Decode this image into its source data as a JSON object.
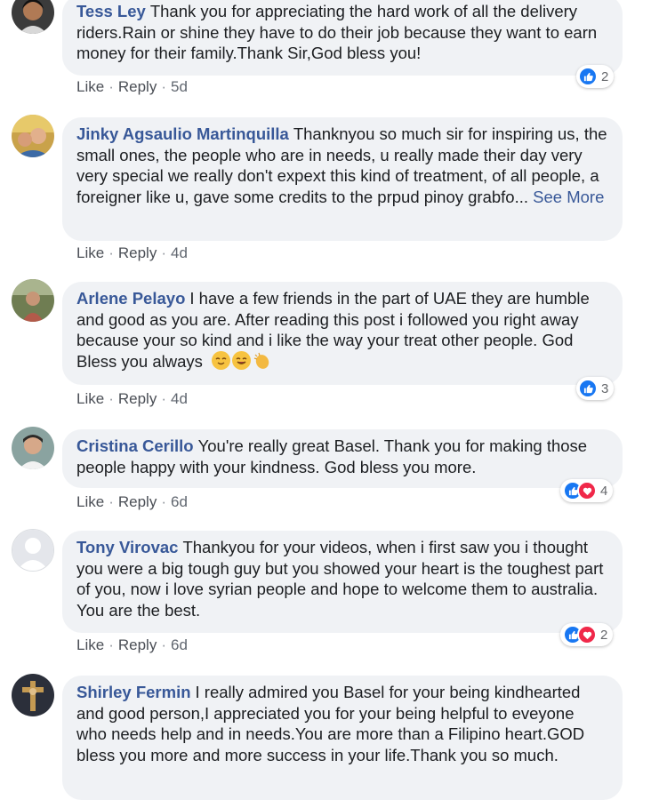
{
  "comments": [
    {
      "author": "Tess Ley",
      "text": "Thank you for appreciating the hard work of all the delivery riders.Rain or shine they have to do their job because they want to earn money for their family.Thank Sir,God bless you!",
      "actions": {
        "like": "Like",
        "reply": "Reply",
        "time": "5d"
      },
      "reactions": {
        "count": "2",
        "types": [
          "like"
        ]
      }
    },
    {
      "author": "Jinky Agsaulio Martinquilla",
      "text": "Thanknyou so much sir for inspiring us, the small ones, the people who are in needs, u really made their day very very special we really don't expext this kind of treatment, of all people, a foreigner like u, gave some credits to the prpud pinoy grabfo...",
      "see_more": "See More",
      "actions": {
        "like": "Like",
        "reply": "Reply",
        "time": "4d"
      }
    },
    {
      "author": "Arlene Pelayo",
      "text": "I have a few friends in the part of UAE they are humble and good as you are. After reading this post i followed you right away because your so kind and i like the way your treat other people. God Bless you always",
      "emojis": [
        "relieved-face-emoji",
        "smiling-face-emoji",
        "clapping-hands-emoji"
      ],
      "actions": {
        "like": "Like",
        "reply": "Reply",
        "time": "4d"
      },
      "reactions": {
        "count": "3",
        "types": [
          "like"
        ]
      }
    },
    {
      "author": "Cristina Cerillo",
      "text": "You're really great Basel. Thank you for making those people happy with your kindness. God bless you more.",
      "actions": {
        "like": "Like",
        "reply": "Reply",
        "time": "6d"
      },
      "reactions": {
        "count": "4",
        "types": [
          "like",
          "love"
        ]
      }
    },
    {
      "author": "Tony Virovac",
      "text": "Thankyou for your videos, when i first saw you i thought you were a big tough guy but you showed your heart is the toughest part of you, now i love syrian people and hope to welcome them to australia. You are the best.",
      "actions": {
        "like": "Like",
        "reply": "Reply",
        "time": "6d"
      },
      "reactions": {
        "count": "2",
        "types": [
          "like",
          "love"
        ]
      }
    },
    {
      "author": "Shirley Fermin",
      "text": "I really admired you Basel for your being kindhearted and good person,I appreciated you for your being helpful to eveyone who needs help and in needs.You are more than a Filipino heart.GOD bless you more and more success in your life.Thank you so much."
    }
  ],
  "colors": {
    "author": "#385898",
    "bubble": "#f0f2f5",
    "like": "#1877f2",
    "love": "#f02849",
    "action": "#616770"
  }
}
